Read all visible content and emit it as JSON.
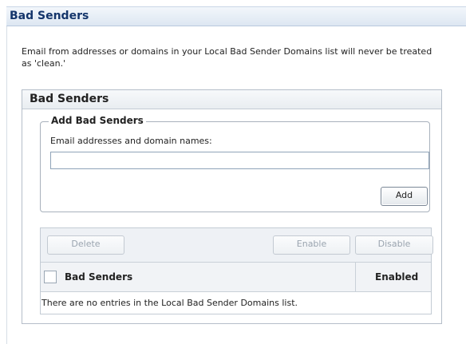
{
  "page": {
    "title": "Bad Senders",
    "description": "Email from addresses or domains in your Local Bad Sender Domains list will never be treated as 'clean.'"
  },
  "panel": {
    "title": "Bad Senders",
    "add_section": {
      "legend": "Add Bad Senders",
      "field_label": "Email addresses and domain names:",
      "field_value": "",
      "add_button": "Add"
    },
    "list": {
      "toolbar": {
        "delete_button": "Delete",
        "enable_button": "Enable",
        "disable_button": "Disable"
      },
      "columns": [
        "Bad Senders",
        "Enabled"
      ],
      "empty_message": "There are no entries in the Local Bad Sender Domains list."
    }
  }
}
